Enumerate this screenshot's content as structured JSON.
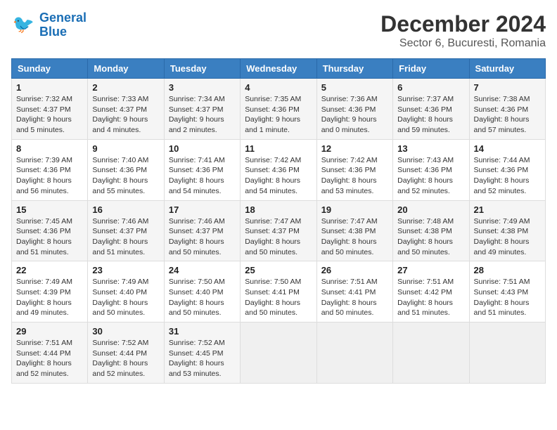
{
  "header": {
    "logo_line1": "General",
    "logo_line2": "Blue",
    "month_title": "December 2024",
    "location": "Sector 6, Bucuresti, Romania"
  },
  "days_of_week": [
    "Sunday",
    "Monday",
    "Tuesday",
    "Wednesday",
    "Thursday",
    "Friday",
    "Saturday"
  ],
  "weeks": [
    [
      {
        "day": "1",
        "sunrise": "7:32 AM",
        "sunset": "4:37 PM",
        "daylight": "9 hours and 5 minutes."
      },
      {
        "day": "2",
        "sunrise": "7:33 AM",
        "sunset": "4:37 PM",
        "daylight": "9 hours and 4 minutes."
      },
      {
        "day": "3",
        "sunrise": "7:34 AM",
        "sunset": "4:37 PM",
        "daylight": "9 hours and 2 minutes."
      },
      {
        "day": "4",
        "sunrise": "7:35 AM",
        "sunset": "4:36 PM",
        "daylight": "9 hours and 1 minute."
      },
      {
        "day": "5",
        "sunrise": "7:36 AM",
        "sunset": "4:36 PM",
        "daylight": "9 hours and 0 minutes."
      },
      {
        "day": "6",
        "sunrise": "7:37 AM",
        "sunset": "4:36 PM",
        "daylight": "8 hours and 59 minutes."
      },
      {
        "day": "7",
        "sunrise": "7:38 AM",
        "sunset": "4:36 PM",
        "daylight": "8 hours and 57 minutes."
      }
    ],
    [
      {
        "day": "8",
        "sunrise": "7:39 AM",
        "sunset": "4:36 PM",
        "daylight": "8 hours and 56 minutes."
      },
      {
        "day": "9",
        "sunrise": "7:40 AM",
        "sunset": "4:36 PM",
        "daylight": "8 hours and 55 minutes."
      },
      {
        "day": "10",
        "sunrise": "7:41 AM",
        "sunset": "4:36 PM",
        "daylight": "8 hours and 54 minutes."
      },
      {
        "day": "11",
        "sunrise": "7:42 AM",
        "sunset": "4:36 PM",
        "daylight": "8 hours and 54 minutes."
      },
      {
        "day": "12",
        "sunrise": "7:42 AM",
        "sunset": "4:36 PM",
        "daylight": "8 hours and 53 minutes."
      },
      {
        "day": "13",
        "sunrise": "7:43 AM",
        "sunset": "4:36 PM",
        "daylight": "8 hours and 52 minutes."
      },
      {
        "day": "14",
        "sunrise": "7:44 AM",
        "sunset": "4:36 PM",
        "daylight": "8 hours and 52 minutes."
      }
    ],
    [
      {
        "day": "15",
        "sunrise": "7:45 AM",
        "sunset": "4:36 PM",
        "daylight": "8 hours and 51 minutes."
      },
      {
        "day": "16",
        "sunrise": "7:46 AM",
        "sunset": "4:37 PM",
        "daylight": "8 hours and 51 minutes."
      },
      {
        "day": "17",
        "sunrise": "7:46 AM",
        "sunset": "4:37 PM",
        "daylight": "8 hours and 50 minutes."
      },
      {
        "day": "18",
        "sunrise": "7:47 AM",
        "sunset": "4:37 PM",
        "daylight": "8 hours and 50 minutes."
      },
      {
        "day": "19",
        "sunrise": "7:47 AM",
        "sunset": "4:38 PM",
        "daylight": "8 hours and 50 minutes."
      },
      {
        "day": "20",
        "sunrise": "7:48 AM",
        "sunset": "4:38 PM",
        "daylight": "8 hours and 50 minutes."
      },
      {
        "day": "21",
        "sunrise": "7:49 AM",
        "sunset": "4:38 PM",
        "daylight": "8 hours and 49 minutes."
      }
    ],
    [
      {
        "day": "22",
        "sunrise": "7:49 AM",
        "sunset": "4:39 PM",
        "daylight": "8 hours and 49 minutes."
      },
      {
        "day": "23",
        "sunrise": "7:49 AM",
        "sunset": "4:40 PM",
        "daylight": "8 hours and 50 minutes."
      },
      {
        "day": "24",
        "sunrise": "7:50 AM",
        "sunset": "4:40 PM",
        "daylight": "8 hours and 50 minutes."
      },
      {
        "day": "25",
        "sunrise": "7:50 AM",
        "sunset": "4:41 PM",
        "daylight": "8 hours and 50 minutes."
      },
      {
        "day": "26",
        "sunrise": "7:51 AM",
        "sunset": "4:41 PM",
        "daylight": "8 hours and 50 minutes."
      },
      {
        "day": "27",
        "sunrise": "7:51 AM",
        "sunset": "4:42 PM",
        "daylight": "8 hours and 51 minutes."
      },
      {
        "day": "28",
        "sunrise": "7:51 AM",
        "sunset": "4:43 PM",
        "daylight": "8 hours and 51 minutes."
      }
    ],
    [
      {
        "day": "29",
        "sunrise": "7:51 AM",
        "sunset": "4:44 PM",
        "daylight": "8 hours and 52 minutes."
      },
      {
        "day": "30",
        "sunrise": "7:52 AM",
        "sunset": "4:44 PM",
        "daylight": "8 hours and 52 minutes."
      },
      {
        "day": "31",
        "sunrise": "7:52 AM",
        "sunset": "4:45 PM",
        "daylight": "8 hours and 53 minutes."
      },
      null,
      null,
      null,
      null
    ]
  ],
  "labels": {
    "sunrise": "Sunrise:",
    "sunset": "Sunset:",
    "daylight": "Daylight:"
  }
}
